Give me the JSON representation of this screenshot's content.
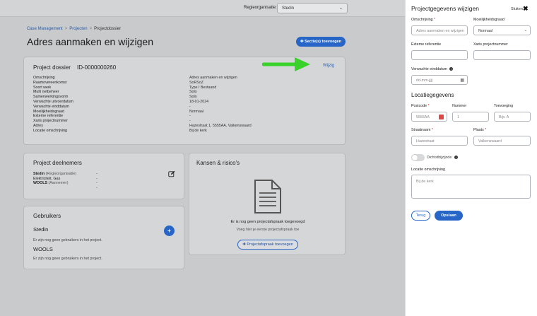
{
  "topbar": {
    "region_label": "Regieorganisatie:",
    "region_value": "Stedin"
  },
  "breadcrumb": {
    "items": [
      "Case Management",
      "Projecten",
      "Projectdossier"
    ]
  },
  "page": {
    "title": "Adres aanmaken en wijzigen",
    "add_section_label": "Sectie(s) toevoegen"
  },
  "dossier": {
    "title": "Project dossier",
    "id": "ID-0000000260",
    "edit_label": "Wijzig",
    "fields": [
      {
        "label": "Omschrijving",
        "value": "Adres aanmaken en wijzigen"
      },
      {
        "label": "Raamovereenkomst",
        "value": "SoRSoZ"
      },
      {
        "label": "Soort werk",
        "value": "Type I Bestaand"
      },
      {
        "label": "Multi netbeheer",
        "value": "Solo"
      },
      {
        "label": "Samenwerkingsvorm",
        "value": "Solo"
      },
      {
        "label": "Verwachte uitvoerdatum",
        "value": "18-01-2024"
      },
      {
        "label": "Verwachte einddatum",
        "value": "-"
      },
      {
        "label": "Moeilijkheidsgraad",
        "value": "Normaal"
      },
      {
        "label": "Externe referentie",
        "value": "-"
      },
      {
        "label": "Xaris projectnummer",
        "value": "-"
      },
      {
        "label": "Adres",
        "value": "Hazestraat 1, 5555AA, Valkenswaard"
      },
      {
        "label": "Locatie omschrijving",
        "value": "Bij de kerk"
      }
    ]
  },
  "deelnemers": {
    "title": "Project deelnemers",
    "rows": [
      {
        "name": "Stedin",
        "role": "(Regieorganisatie)",
        "value": "-"
      },
      {
        "name": "Elektriciteit, Gas",
        "role": "",
        "value": "-"
      },
      {
        "name": "WOOLS",
        "role": "(Aannemer)",
        "value": "-"
      },
      {
        "name": "",
        "role": "",
        "value": "-"
      }
    ]
  },
  "gebruikers": {
    "title": "Gebruikers",
    "orgs": [
      {
        "name": "Stedin",
        "empty": "Er zijn nog geen gebruikers in het project."
      },
      {
        "name": "WOOLS",
        "empty": "Er zijn nog geen gebruikers in het project."
      }
    ]
  },
  "kansen": {
    "title": "Kansen & risico's",
    "empty": "Er is nog geen projectafspraak toegevoegd",
    "hint": "Voeg hier je eerste projectafspraak toe",
    "button": "Projectafspraak toevoegen"
  },
  "panel": {
    "title": "Projectgegevens wijzigen",
    "close_label": "Sluiten",
    "omschrijving_label": "Omschrijving",
    "omschrijving_placeholder": "Adres aanmaken en wijzigen",
    "moeilijkheid_label": "Moeilijkheidsgraad",
    "moeilijkheid_value": "Normaal",
    "extref_label": "Externe referentie",
    "xaris_label": "Xaris projectnummer",
    "einddatum_label": "Verwachte einddatum",
    "einddatum_placeholder": "dd-mm-jjjj",
    "locatie_head": "Locatiegegevens",
    "postcode_label": "Postcode",
    "postcode_placeholder": "5555AA",
    "nummer_label": "Nummer",
    "nummer_placeholder": "1",
    "toevoeging_label": "Toevoeging",
    "toevoeging_placeholder": "Bijv. A",
    "straat_label": "Straatnaam",
    "straat_placeholder": "Hazestraat",
    "plaats_label": "Plaats",
    "plaats_placeholder": "Valkenswaard",
    "dichtstbij_label": "Dichtstbijzijnde",
    "locatieoms_label": "Locatie omschrijving",
    "locatieoms_placeholder": "Bij de kerk",
    "terug_label": "Terug",
    "opslaan_label": "Opslaan",
    "required_mark": "*"
  }
}
